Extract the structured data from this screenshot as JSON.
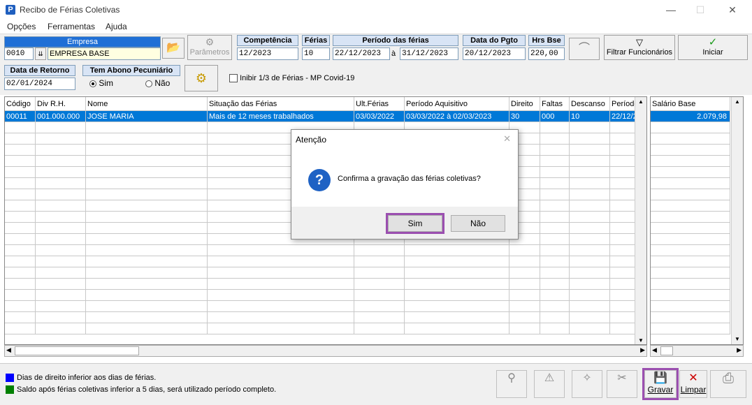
{
  "window": {
    "title": "Recibo de Férias Coletivas",
    "app_icon": "P"
  },
  "menu": [
    "Opções",
    "Ferramentas",
    "Ajuda"
  ],
  "toolbar": {
    "empresa_label": "Empresa",
    "empresa_code": "0010",
    "empresa_name": "EMPRESA BASE",
    "parametros_label": "Parâmetros",
    "competencia_label": "Competência",
    "competencia_value": "12/2023",
    "ferias_label": "Férias",
    "ferias_value": "10",
    "periodo_label": "Período das férias",
    "periodo_inicio": "22/12/2023",
    "periodo_sep": "à",
    "periodo_fim": "31/12/2023",
    "data_pgto_label": "Data do Pgto",
    "data_pgto_value": "20/12/2023",
    "hrs_bse_label": "Hrs Bse",
    "hrs_bse_value": "220,00",
    "filtrar_label": "Filtrar Funcionários",
    "iniciar_label": "Iniciar",
    "data_retorno_label": "Data de Retorno",
    "data_retorno_value": "02/01/2024",
    "abono_label": "Tem Abono Pecuniário",
    "abono_sim": "Sim",
    "abono_nao": "Não",
    "inibir_label": "Inibir 1/3 de Férias - MP Covid-19"
  },
  "grid": {
    "columns": [
      "Código",
      "Div R.H.",
      "Nome",
      "Situação das Férias",
      "Ult.Férias",
      "Período Aquisitivo",
      "Direito",
      "Faltas",
      "Descanso",
      "Período"
    ],
    "rows": [
      [
        "00011",
        "001.000.000",
        "JOSE MARIA",
        "Mais de 12 meses trabalhados",
        "03/03/2022",
        "03/03/2022 à 02/03/2023",
        "30",
        "000",
        "10",
        "22/12/2"
      ]
    ]
  },
  "grid2": {
    "column": "Salário Base",
    "rows": [
      "2.079,98"
    ]
  },
  "legend": [
    {
      "color": "#0000ff",
      "text": "Dias de direito inferior aos dias de férias."
    },
    {
      "color": "#008000",
      "text": "Saldo após férias coletivas inferior a 5 dias, será utilizado período completo."
    }
  ],
  "bottom_buttons": {
    "gravar": "Gravar",
    "limpar": "Limpar"
  },
  "dialog": {
    "title": "Atenção",
    "message": "Confirma a gravação das férias coletivas?",
    "sim": "Sim",
    "nao": "Não"
  },
  "colors": {
    "accent": "#0078d7",
    "highlight": "#9b4fb0"
  }
}
